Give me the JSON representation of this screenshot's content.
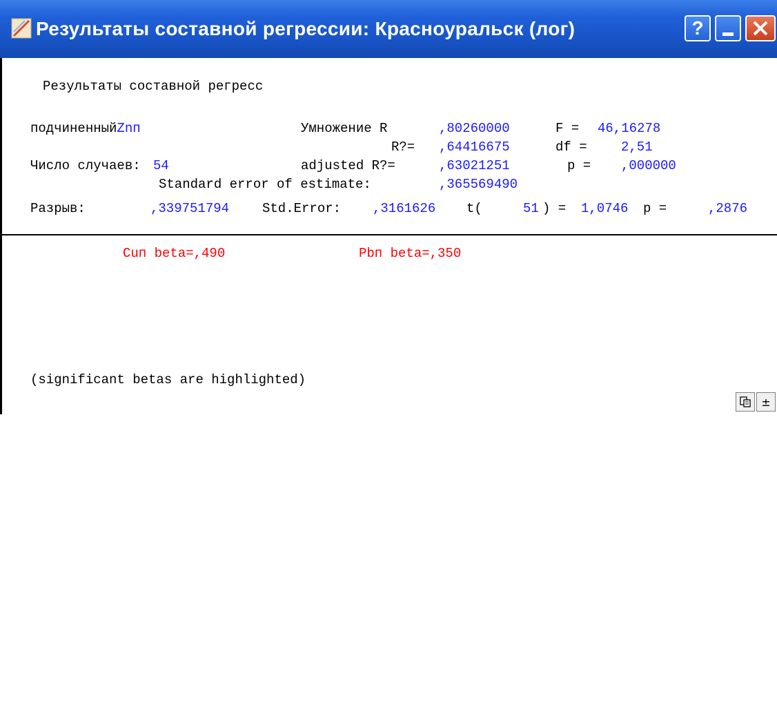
{
  "window": {
    "title": "Результаты составной регрессии: Красноуральск (лог)",
    "buttons": {
      "help": "?",
      "close": "X"
    }
  },
  "report": {
    "heading": "Результаты составной регресс",
    "dependent_label": "подчиненный",
    "dependent_value": "Znп",
    "multiple_r_label": "Умножение R",
    "multiple_r_value": ",80260000",
    "f_label": "F =",
    "f_value": "46,16278",
    "r2_label": "R?=",
    "r2_value": ",64416675",
    "df_label": "df =",
    "df_value": "2,51",
    "cases_label": "Число случаев:",
    "cases_value": "54",
    "adj_r2_label": "adjusted R?=",
    "adj_r2_value": ",63021251",
    "p_label": "p =",
    "p_value": ",000000",
    "see_label": "Standard error of estimate:",
    "see_value": ",365569490",
    "intercept_label": "Разрыв:",
    "intercept_value": ",339751794",
    "std_err_label": "Std.Error:",
    "std_err_value": ",3161626",
    "t_label": "t(",
    "t_df": "51",
    "t_eq": ") =",
    "t_value": "1,0746",
    "p2_label": "p =",
    "p2_value": ",2876"
  },
  "betas": [
    {
      "label": "Cuп beta=,490"
    },
    {
      "label": "Pbп beta=,350"
    }
  ],
  "footnote": "(significant betas are highlighted)",
  "corner_buttons": {
    "copy_icon": "copy-icon",
    "toggle_icon": "plus-minus-icon"
  },
  "colors": {
    "value": "#1a1aff",
    "highlight": "#ff0000",
    "title_bar": "#1f5fd8"
  }
}
